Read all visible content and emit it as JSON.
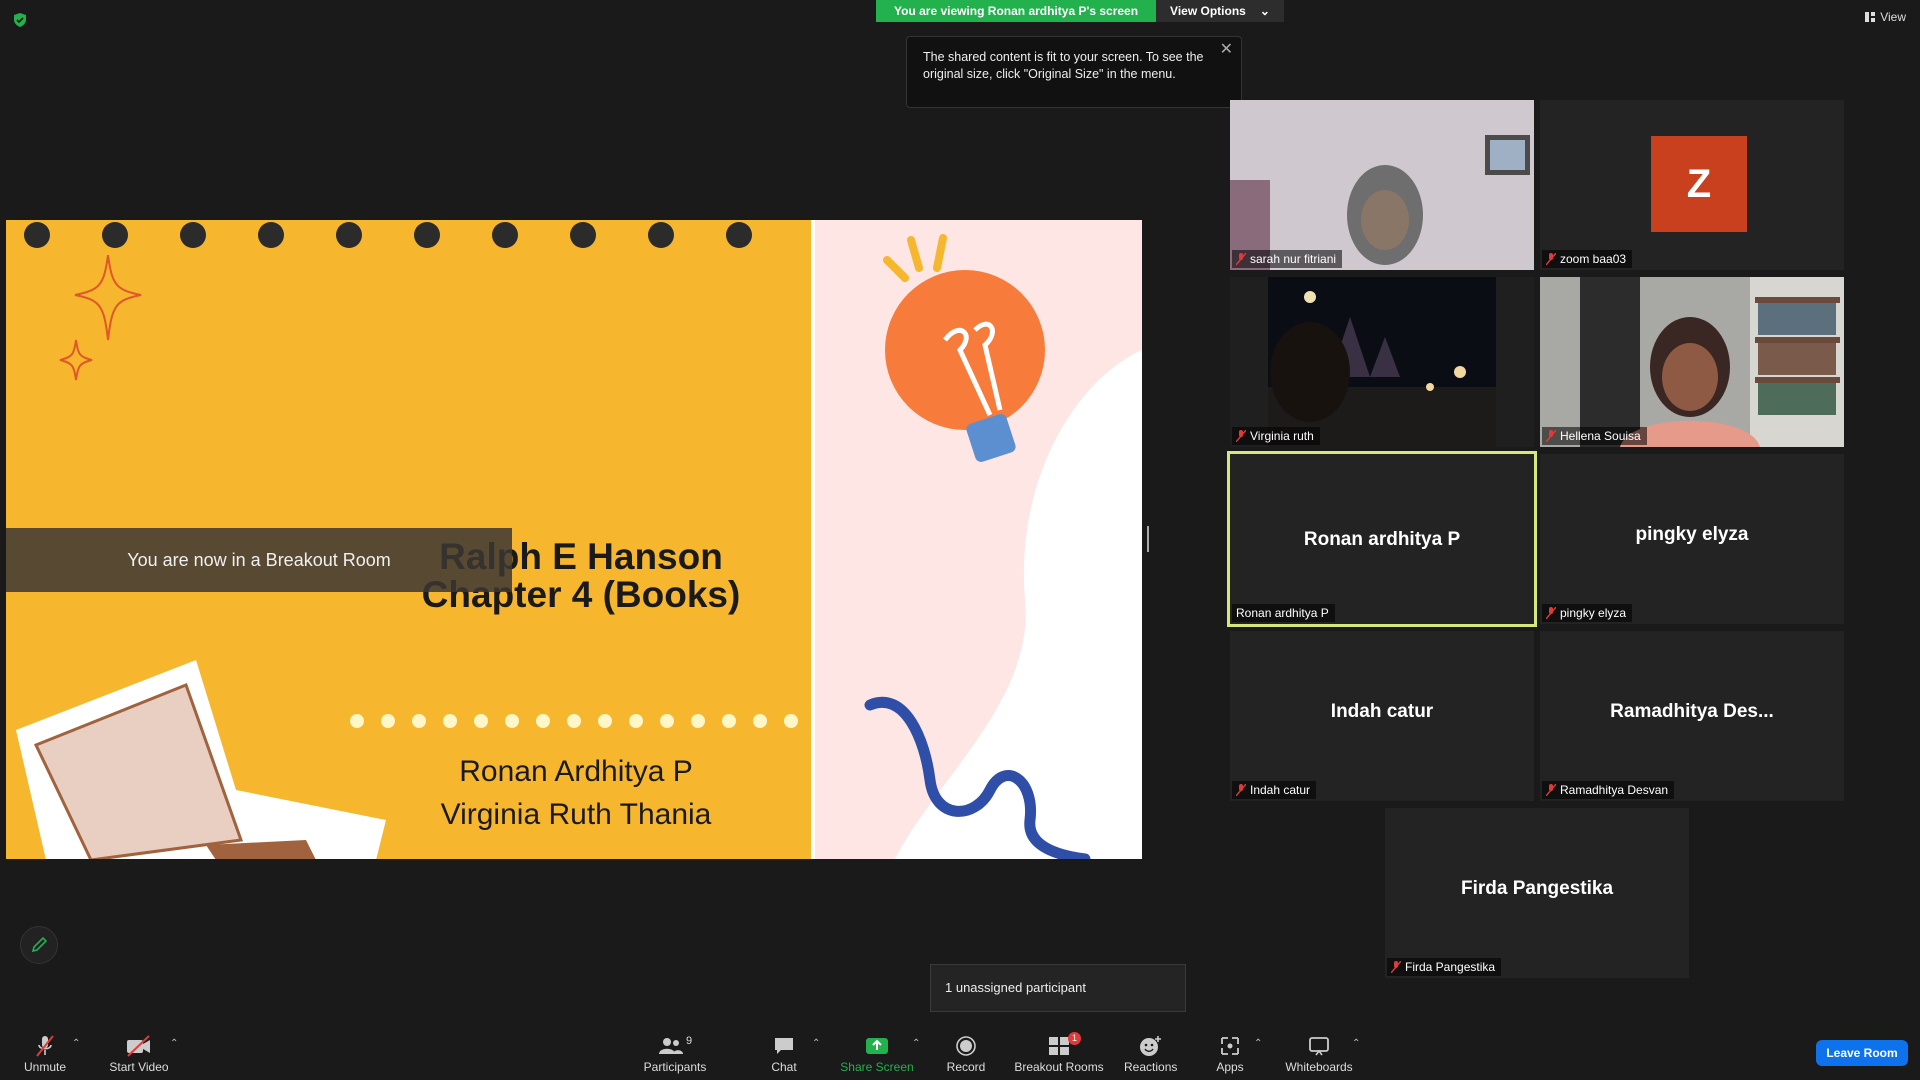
{
  "banner": {
    "viewing_text": "You are viewing Ronan ardhitya P's screen",
    "view_options_label": "View Options"
  },
  "top_right": {
    "view_label": "View"
  },
  "tooltip": {
    "text": "The shared content is fit to your screen. To see the original size, click \"Original Size\" in the menu."
  },
  "slide": {
    "title_line1": "Ralph E Hanson",
    "title_line2": "Chapter 4 (Books)",
    "name1": "Ronan Ardhitya P",
    "name2": "Virginia Ruth Thania"
  },
  "breakout_toast": "You are now in a Breakout Room",
  "tiles": [
    {
      "label": "sarah nur fitriani",
      "muted": true
    },
    {
      "label": "zoom baa03",
      "avatar_letter": "Z",
      "muted": true
    },
    {
      "label": "Virginia ruth",
      "muted": true
    },
    {
      "label": "Hellena Souisa",
      "muted": true
    },
    {
      "center_name": "Ronan ardhitya P",
      "label": "Ronan ardhitya P",
      "muted": false,
      "active": true
    },
    {
      "center_name": "pingky elyza",
      "label": "pingky elyza",
      "muted": true
    },
    {
      "center_name": "Indah catur",
      "label": "Indah catur",
      "muted": true
    },
    {
      "center_name": "Ramadhitya  Des...",
      "label": "Ramadhitya Desvan",
      "muted": true
    },
    {
      "center_name": "Firda Pangestika",
      "label": "Firda Pangestika",
      "muted": true
    }
  ],
  "unassigned": "1 unassigned participant",
  "toolbar": {
    "unmute": "Unmute",
    "start_video": "Start Video",
    "participants": "Participants",
    "participants_count": "9",
    "chat": "Chat",
    "share_screen": "Share Screen",
    "record": "Record",
    "breakout_rooms": "Breakout Rooms",
    "breakout_badge": "1",
    "reactions": "Reactions",
    "apps": "Apps",
    "whiteboards": "Whiteboards",
    "leave_room": "Leave Room"
  },
  "colors": {
    "share_green": "#22b14c",
    "leave_blue": "#0e72ed",
    "active_border": "#d7e77b",
    "slide_yellow": "#f6b72e",
    "slide_pink": "#fde6e3",
    "avatar_orange": "#c9401e"
  }
}
